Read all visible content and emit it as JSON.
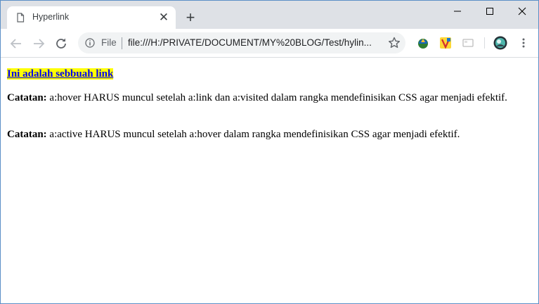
{
  "tab": {
    "title": "Hyperlink"
  },
  "address_bar": {
    "scheme_label": "File",
    "url": "file:///H:/PRIVATE/DOCUMENT/MY%20BLOG/Test/hylin..."
  },
  "page": {
    "link_text": "Ini adalah sebbuah link",
    "note1_label": "Catatan:",
    "note1_text": " a:hover HARUS muncul setelah a:link dan a:visited dalam rangka mendefinisikan CSS agar menjadi efektif.",
    "note2_label": "Catatan:",
    "note2_text": " a:active HARUS muncul setelah a:hover dalam rangka mendefinisikan CSS agar menjadi efektif."
  },
  "colors": {
    "link_highlight": "#ffff00",
    "link_color": "#0000ee",
    "chrome_frame": "#dee1e6"
  }
}
